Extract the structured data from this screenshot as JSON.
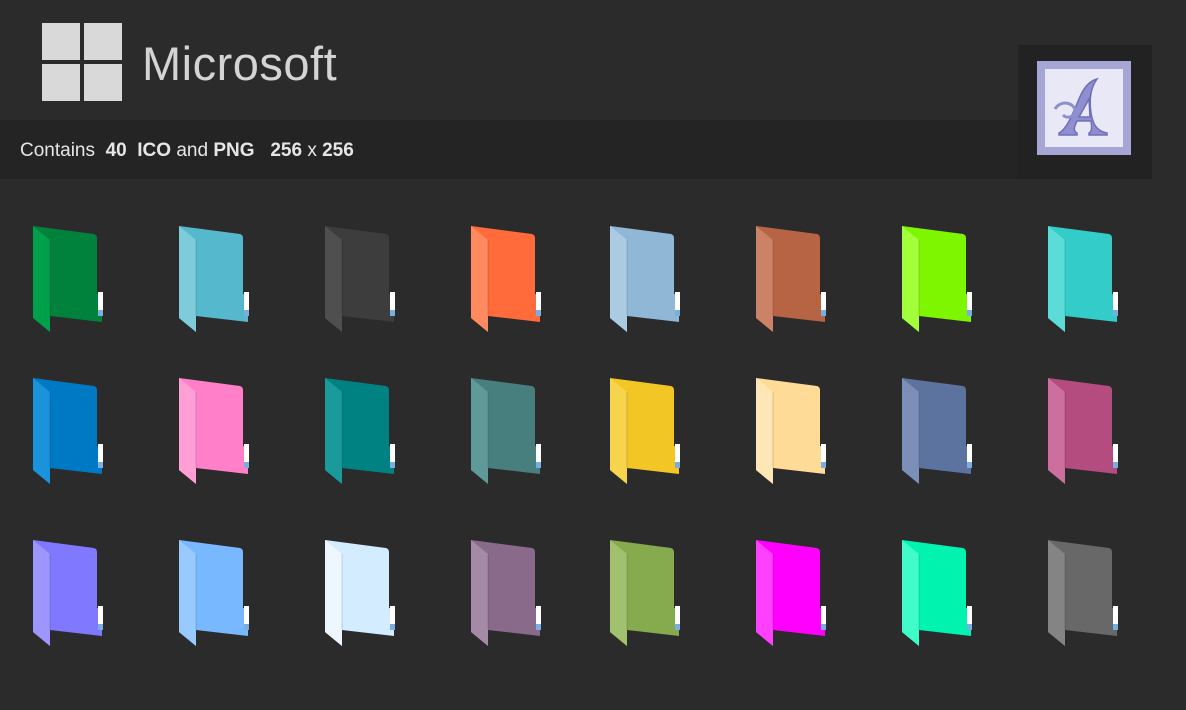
{
  "header": {
    "brand": "Microsoft",
    "logo_icon": "windows-logo-icon",
    "logo_color": "#d9d9d9",
    "badge_icon": "blackletter-a-icon",
    "badge_colors": {
      "frame": "#a6a6d6",
      "fill": "#e8e8f6",
      "letter": "#8f8fcf"
    }
  },
  "info": {
    "prefix": "Contains",
    "count": "40",
    "fmt1": "ICO",
    "conj": "and",
    "fmt2": "PNG",
    "w": "256",
    "x": "x",
    "h": "256"
  },
  "folders": [
    {
      "name": "folder-green-icon",
      "color": "#00813c",
      "light": "#00a04a"
    },
    {
      "name": "folder-sky-blue-icon",
      "color": "#55b8cc",
      "light": "#7dcbdb"
    },
    {
      "name": "folder-dark-gray-icon",
      "color": "#3d3d3d",
      "light": "#4f4f4f"
    },
    {
      "name": "folder-orange-icon",
      "color": "#ff6b3a",
      "light": "#ff8a60"
    },
    {
      "name": "folder-light-steel-blue-icon",
      "color": "#90b8d6",
      "light": "#abcbe3"
    },
    {
      "name": "folder-terracotta-icon",
      "color": "#b76444",
      "light": "#cc8266"
    },
    {
      "name": "folder-lime-icon",
      "color": "#7ef600",
      "light": "#a2ff3a"
    },
    {
      "name": "folder-turquoise-icon",
      "color": "#33ccc8",
      "light": "#5cdcd8"
    },
    {
      "name": "folder-blue-icon",
      "color": "#0079c4",
      "light": "#1a92dc"
    },
    {
      "name": "folder-pink-icon",
      "color": "#ff80c8",
      "light": "#ff9fd6"
    },
    {
      "name": "folder-teal-icon",
      "color": "#008283",
      "light": "#1a9a9a"
    },
    {
      "name": "folder-slate-teal-icon",
      "color": "#467f7e",
      "light": "#5f9a98"
    },
    {
      "name": "folder-yellow-icon",
      "color": "#f2c624",
      "light": "#f6d44d"
    },
    {
      "name": "folder-peach-icon",
      "color": "#ffdb98",
      "light": "#ffe6b6"
    },
    {
      "name": "folder-slate-blue-icon",
      "color": "#5c729f",
      "light": "#7b8fb8"
    },
    {
      "name": "folder-magenta-rose-icon",
      "color": "#b44c80",
      "light": "#cc6f9f"
    },
    {
      "name": "folder-periwinkle-icon",
      "color": "#8078ff",
      "light": "#9d96ff"
    },
    {
      "name": "folder-light-blue-icon",
      "color": "#78b8ff",
      "light": "#98caff"
    },
    {
      "name": "folder-pale-blue-icon",
      "color": "#d4ecff",
      "light": "#eef7ff"
    },
    {
      "name": "folder-mauve-icon",
      "color": "#8a6a8a",
      "light": "#a58aa5"
    },
    {
      "name": "folder-olive-icon",
      "color": "#86aa4e",
      "light": "#a1c16e"
    },
    {
      "name": "folder-fuchsia-icon",
      "color": "#ff00ff",
      "light": "#ff40ff"
    },
    {
      "name": "folder-mint-icon",
      "color": "#00f4b0",
      "light": "#40fcc8"
    },
    {
      "name": "folder-gray-icon",
      "color": "#686868",
      "light": "#848484"
    }
  ]
}
